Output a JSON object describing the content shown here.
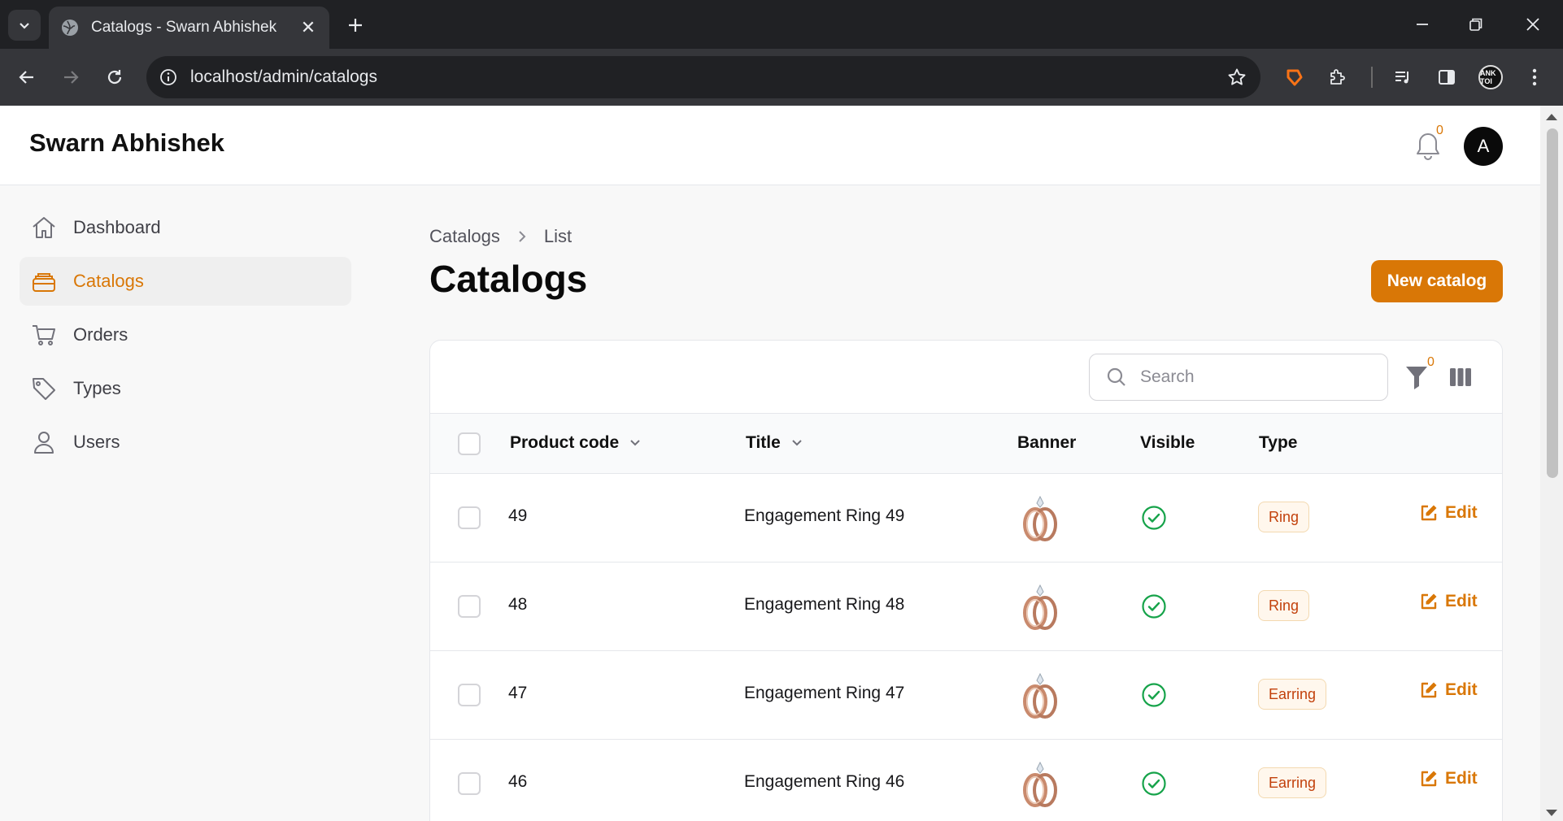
{
  "browser": {
    "tab_title": "Catalogs - Swarn Abhishek",
    "url": "localhost/admin/catalogs",
    "profile_label": "ANK TOI"
  },
  "header": {
    "brand": "Swarn Abhishek",
    "notification_count": "0",
    "avatar_initial": "A"
  },
  "sidebar": {
    "items": [
      {
        "label": "Dashboard",
        "icon": "home-icon"
      },
      {
        "label": "Catalogs",
        "icon": "catalog-stack-icon",
        "active": true
      },
      {
        "label": "Orders",
        "icon": "cart-icon"
      },
      {
        "label": "Types",
        "icon": "tag-icon"
      },
      {
        "label": "Users",
        "icon": "user-icon"
      }
    ]
  },
  "main": {
    "breadcrumb": [
      "Catalogs",
      "List"
    ],
    "title": "Catalogs",
    "new_button": "New catalog",
    "search_placeholder": "Search",
    "filter_count": "0",
    "columns": [
      "Product code",
      "Title",
      "Banner",
      "Visible",
      "Type"
    ],
    "rows": [
      {
        "code": "49",
        "title": "Engagement Ring 49",
        "visible": true,
        "type": "Ring",
        "edit": "Edit"
      },
      {
        "code": "48",
        "title": "Engagement Ring 48",
        "visible": true,
        "type": "Ring",
        "edit": "Edit"
      },
      {
        "code": "47",
        "title": "Engagement Ring 47",
        "visible": true,
        "type": "Earring",
        "edit": "Edit"
      },
      {
        "code": "46",
        "title": "Engagement Ring 46",
        "visible": true,
        "type": "Earring",
        "edit": "Edit"
      }
    ]
  },
  "colors": {
    "accent": "#d97706",
    "success": "#16a34a",
    "chrome_dark": "#202124",
    "chrome_mid": "#35363a"
  }
}
